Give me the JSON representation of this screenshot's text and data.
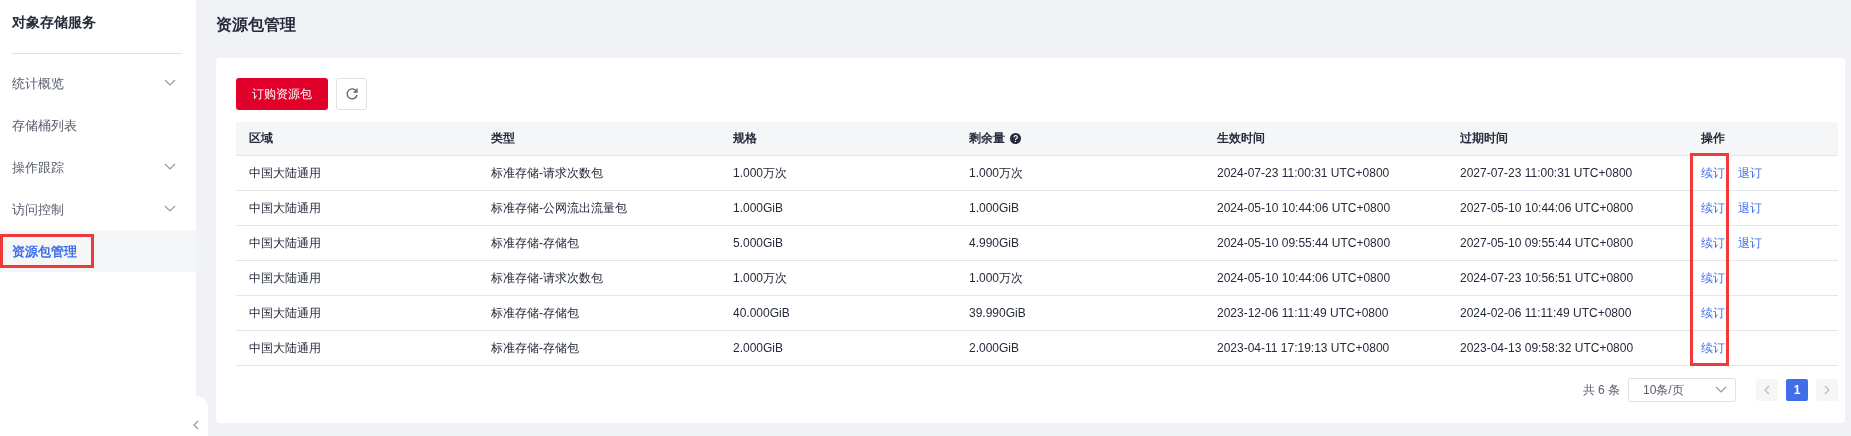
{
  "sidebar": {
    "title": "对象存储服务",
    "items": [
      {
        "label": "统计概览",
        "kind": "group",
        "selected": false,
        "highlighted": false
      },
      {
        "label": "存储桶列表",
        "kind": "link",
        "selected": false,
        "highlighted": false
      },
      {
        "label": "操作跟踪",
        "kind": "group",
        "selected": false,
        "highlighted": false
      },
      {
        "label": "访问控制",
        "kind": "group",
        "selected": false,
        "highlighted": false
      },
      {
        "label": "资源包管理",
        "kind": "link",
        "selected": true,
        "highlighted": true
      }
    ]
  },
  "page": {
    "title": "资源包管理"
  },
  "toolbar": {
    "order_button": "订购资源包"
  },
  "table": {
    "columns": [
      {
        "label": "区域",
        "help": false
      },
      {
        "label": "类型",
        "help": false
      },
      {
        "label": "规格",
        "help": false
      },
      {
        "label": "剩余量",
        "help": true
      },
      {
        "label": "生效时间",
        "help": false
      },
      {
        "label": "过期时间",
        "help": false
      },
      {
        "label": "操作",
        "help": false
      }
    ],
    "actions_highlighted": true,
    "rows": [
      {
        "cells": [
          "中国大陆通用",
          "标准存储-请求次数包",
          "1.000万次",
          "1.000万次",
          "2024-07-23 11:00:31 UTC+0800",
          "2027-07-23 11:00:31 UTC+0800"
        ],
        "actions": [
          "续订",
          "退订"
        ]
      },
      {
        "cells": [
          "中国大陆通用",
          "标准存储-公网流出流量包",
          "1.000GiB",
          "1.000GiB",
          "2024-05-10 10:44:06 UTC+0800",
          "2027-05-10 10:44:06 UTC+0800"
        ],
        "actions": [
          "续订",
          "退订"
        ]
      },
      {
        "cells": [
          "中国大陆通用",
          "标准存储-存储包",
          "5.000GiB",
          "4.990GiB",
          "2024-05-10 09:55:44 UTC+0800",
          "2027-05-10 09:55:44 UTC+0800"
        ],
        "actions": [
          "续订",
          "退订"
        ]
      },
      {
        "cells": [
          "中国大陆通用",
          "标准存储-请求次数包",
          "1.000万次",
          "1.000万次",
          "2024-05-10 10:44:06 UTC+0800",
          "2024-07-23 10:56:51 UTC+0800"
        ],
        "actions": [
          "续订"
        ]
      },
      {
        "cells": [
          "中国大陆通用",
          "标准存储-存储包",
          "40.000GiB",
          "39.990GiB",
          "2023-12-06 11:11:49 UTC+0800",
          "2024-02-06 11:11:49 UTC+0800"
        ],
        "actions": [
          "续订"
        ]
      },
      {
        "cells": [
          "中国大陆通用",
          "标准存储-存储包",
          "2.000GiB",
          "2.000GiB",
          "2023-04-11 17:19:13 UTC+0800",
          "2023-04-13 09:58:32 UTC+0800"
        ],
        "actions": [
          "续订"
        ]
      }
    ]
  },
  "pagination": {
    "total": "共 6 条",
    "page_size": "10条/页",
    "pages": [
      {
        "label": "1",
        "selected": true
      }
    ]
  }
}
